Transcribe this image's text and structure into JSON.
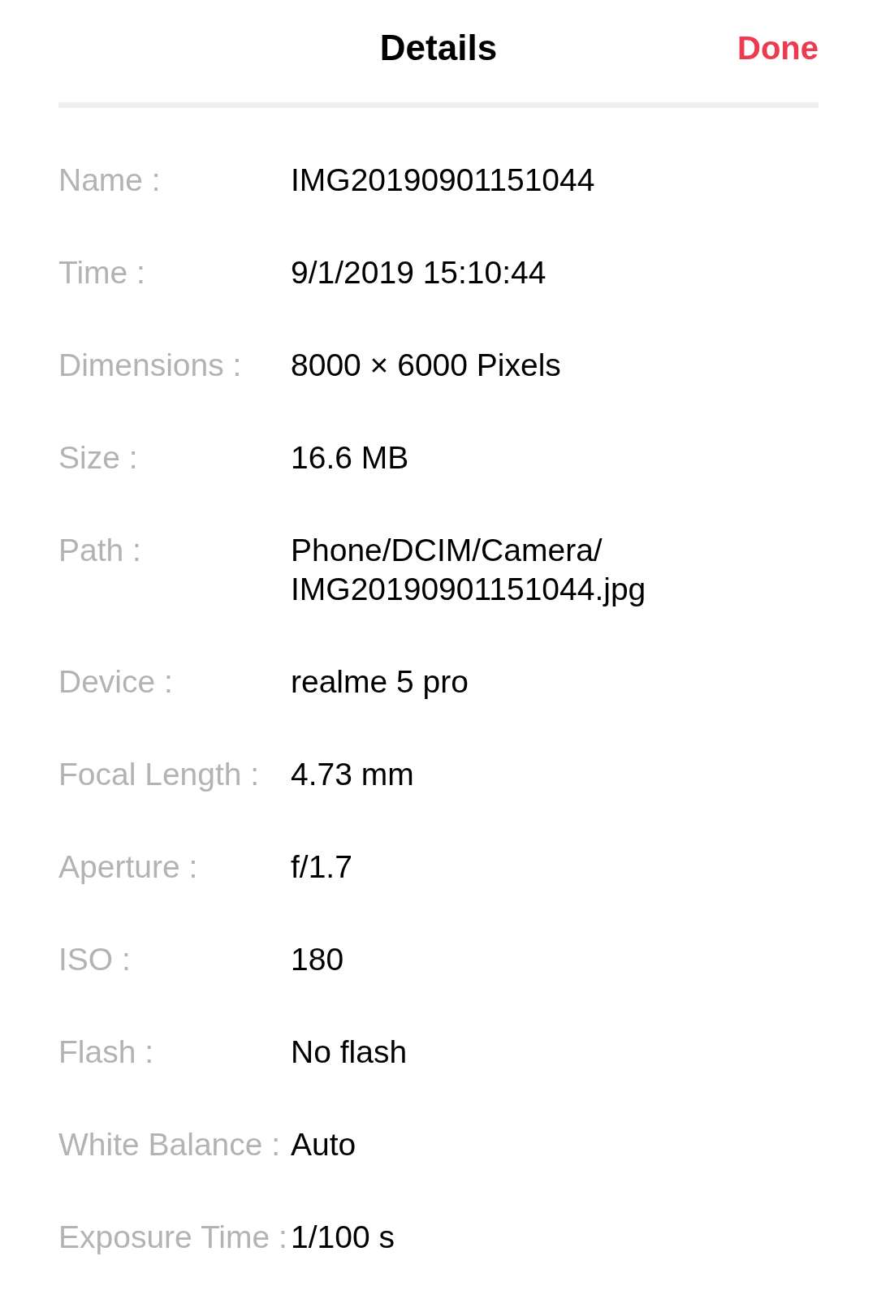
{
  "header": {
    "title": "Details",
    "done_button": "Done"
  },
  "details": [
    {
      "label": "Name :",
      "value": "IMG20190901151044"
    },
    {
      "label": "Time :",
      "value": "9/1/2019 15:10:44"
    },
    {
      "label": "Dimensions :",
      "value": "8000 × 6000 Pixels"
    },
    {
      "label": "Size :",
      "value": "16.6 MB"
    },
    {
      "label": "Path :",
      "value": "Phone/DCIM/Camera/IMG20190901151044.jpg"
    },
    {
      "label": "Device :",
      "value": "realme 5 pro"
    },
    {
      "label": "Focal Length :",
      "value": "4.73 mm"
    },
    {
      "label": "Aperture :",
      "value": "f/1.7"
    },
    {
      "label": "ISO :",
      "value": "180"
    },
    {
      "label": "Flash :",
      "value": "No flash"
    },
    {
      "label": "White Balance :",
      "value": "Auto"
    },
    {
      "label": "Exposure Time :",
      "value": "1/100 s"
    }
  ]
}
